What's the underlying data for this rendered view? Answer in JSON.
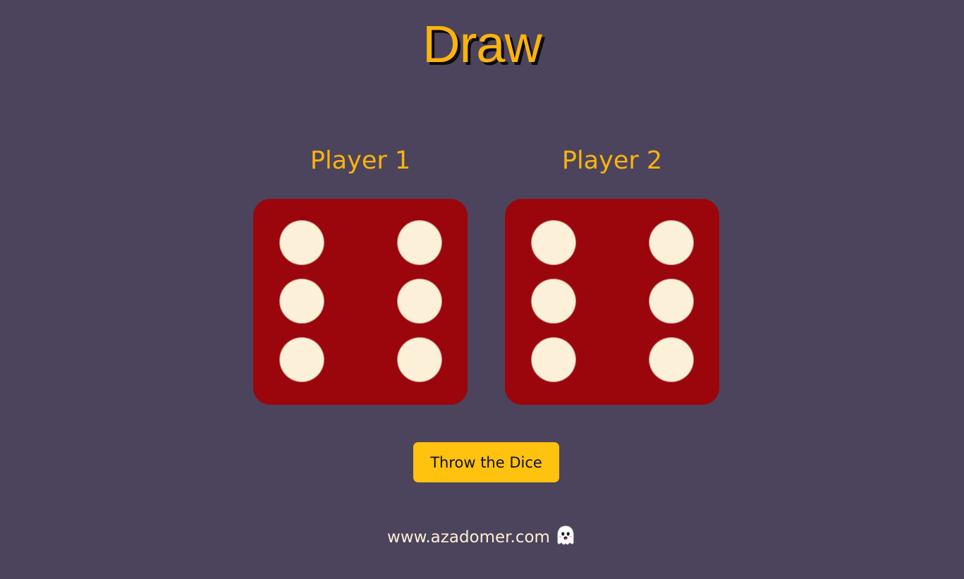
{
  "header": {
    "title": "Draw"
  },
  "players": [
    {
      "label": "Player 1",
      "die_value": 6
    },
    {
      "label": "Player 2",
      "die_value": 6
    }
  ],
  "controls": {
    "throw_label": "Throw the Dice"
  },
  "footer": {
    "site_link": "www.azadomer.com",
    "icon": "ghost-icon"
  },
  "colors": {
    "background": "#4c445c",
    "accent": "#fbb30d",
    "die_face": "#9b060d",
    "pip": "#fcf0d8",
    "button": "#fec20f",
    "footer_text": "#fdf0d6"
  }
}
